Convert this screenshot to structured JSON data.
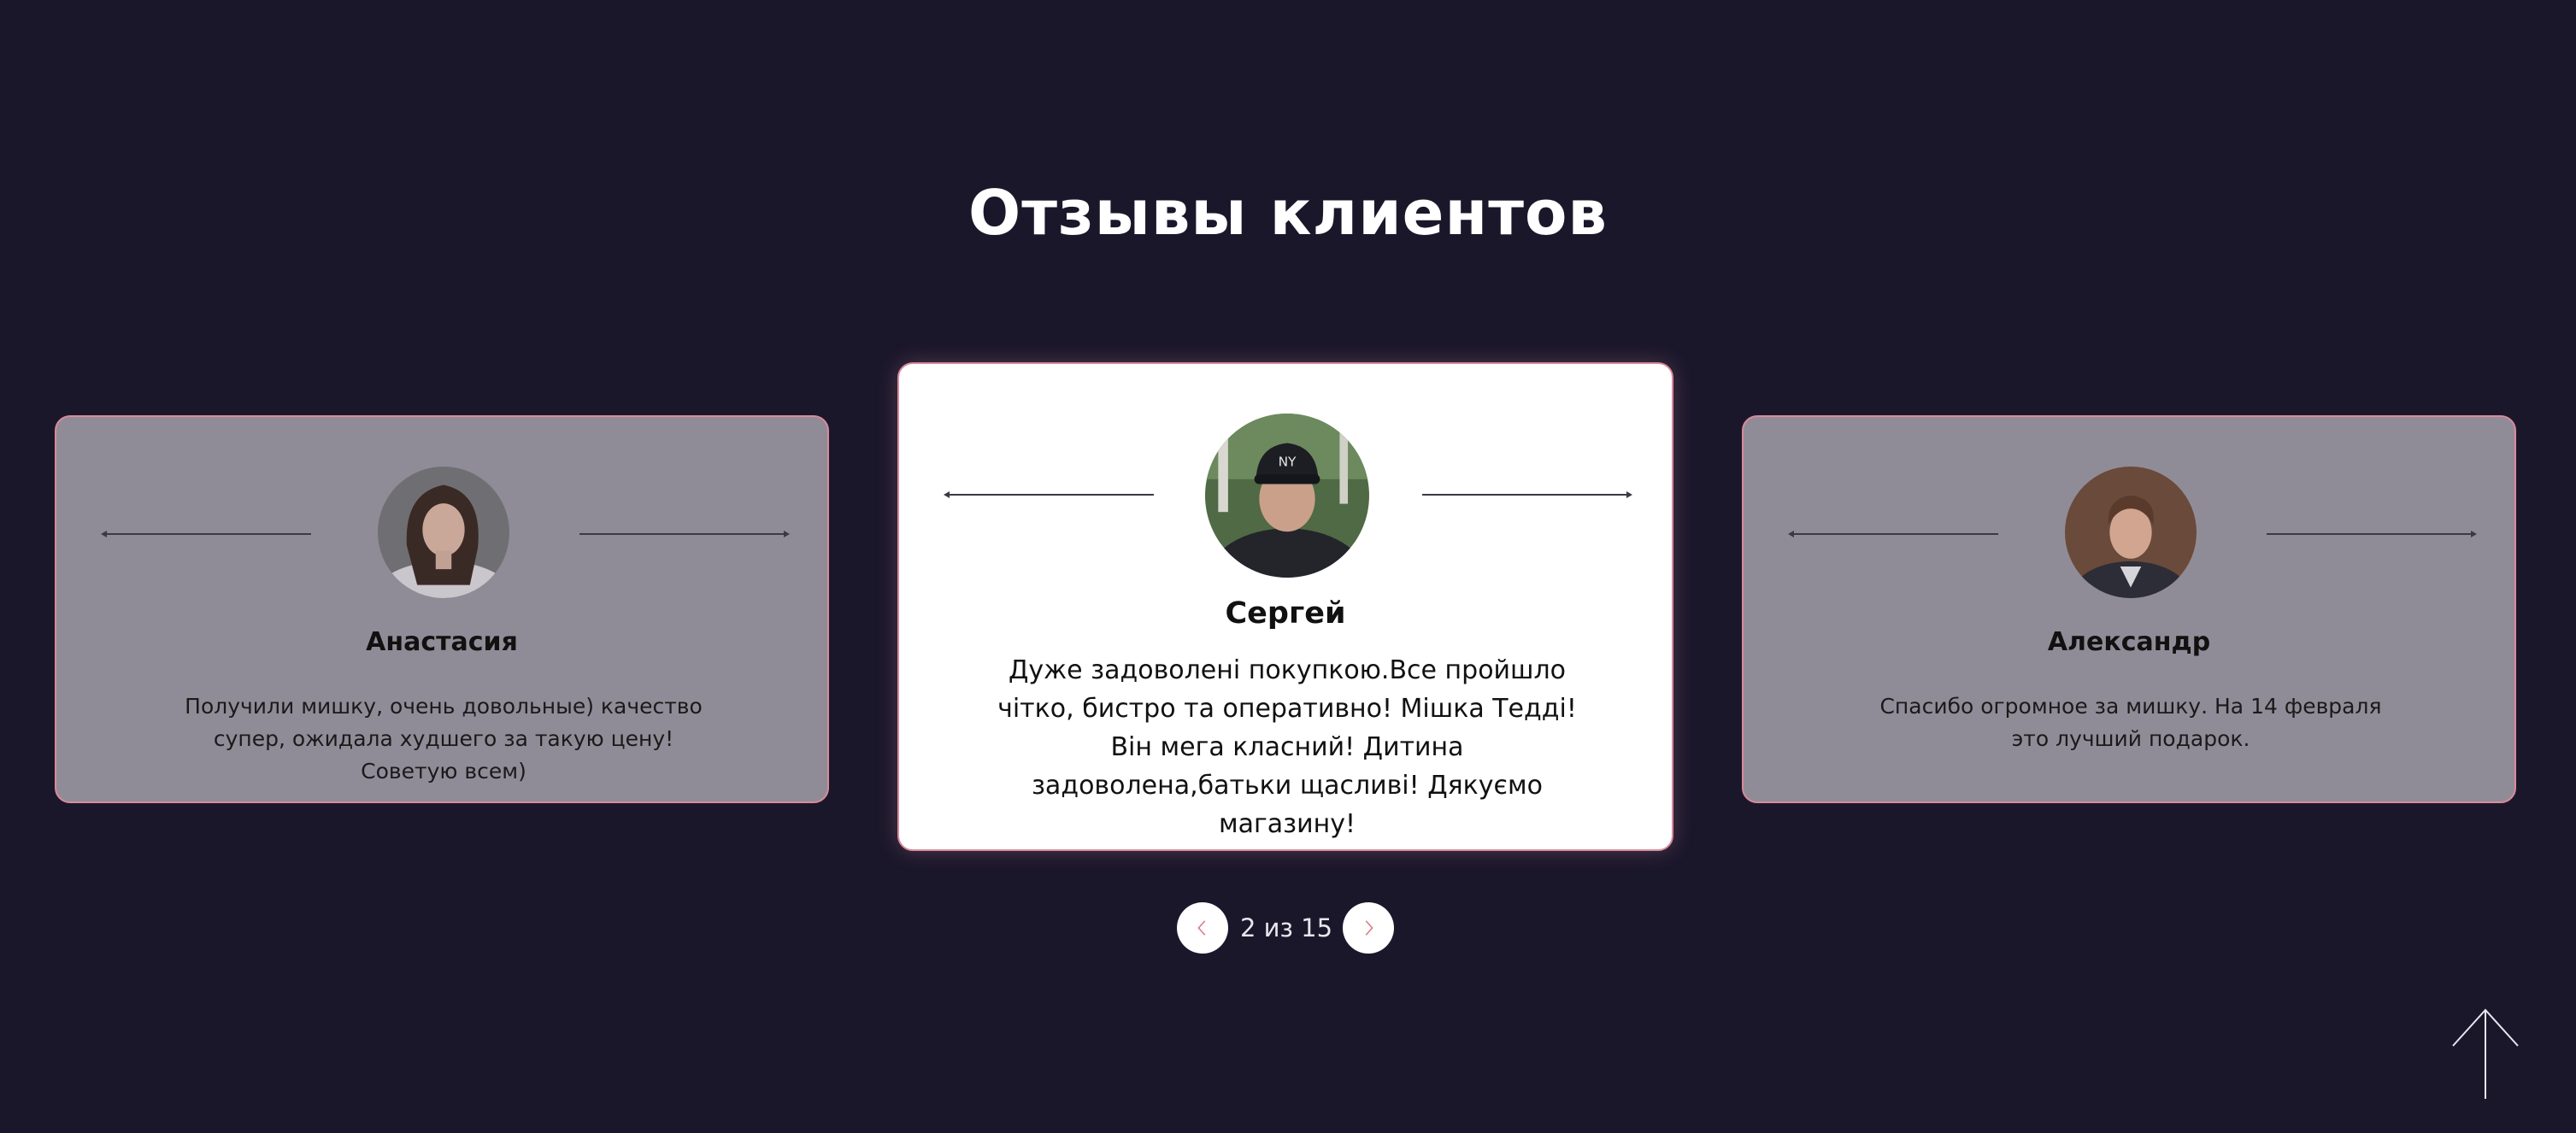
{
  "section": {
    "title": "Отзывы клиентов"
  },
  "reviews": [
    {
      "name": "Анастасия",
      "text": "Получили мишку, очень довольные) качество супер, ожидала худшего за такую цену! Советую всем)"
    },
    {
      "name": "Сергей",
      "text": "Дуже задоволені покупкою.Все пройшло чітко, бистро та оперативно! Мішка Тедді! Він мега класний! Дитина задоволена,батьки щасливі! Дякуємо магазину!"
    },
    {
      "name": "Александр",
      "text": "Спасибо огромное за мишку. На 14 февраля это лучший подарок."
    }
  ],
  "pager": {
    "counter": "2 из 15",
    "prev_icon": "chevron-left-icon",
    "next_icon": "chevron-right-icon"
  },
  "scroll_top_icon": "arrow-up-icon",
  "colors": {
    "background": "#1b172b",
    "card_active": "#ffffff",
    "card_inactive": "#908c97",
    "accent": "#d98a9a"
  }
}
